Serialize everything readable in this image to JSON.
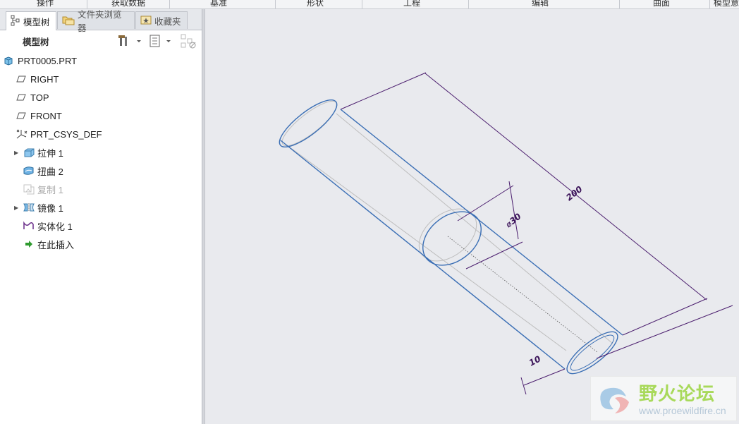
{
  "ribbon_groups": [
    "操作",
    "获取数据",
    "基准",
    "形状",
    "工程",
    "编辑",
    "曲面",
    "模型意"
  ],
  "panel_tabs": [
    {
      "label": "模型树",
      "icon": "model-tree-icon",
      "active": true
    },
    {
      "label": "文件夹浏览器",
      "icon": "folder-browser-icon",
      "active": false
    },
    {
      "label": "收藏夹",
      "icon": "favorites-icon",
      "active": false
    }
  ],
  "tree_header": {
    "title": "模型树"
  },
  "tree": {
    "root": {
      "label": "PRT0005.PRT",
      "icon": "part-icon"
    },
    "items": [
      {
        "label": "RIGHT",
        "icon": "datum-plane-icon",
        "expandable": false,
        "disabled": false
      },
      {
        "label": "TOP",
        "icon": "datum-plane-icon",
        "expandable": false,
        "disabled": false
      },
      {
        "label": "FRONT",
        "icon": "datum-plane-icon",
        "expandable": false,
        "disabled": false
      },
      {
        "label": "PRT_CSYS_DEF",
        "icon": "coordinate-system-icon",
        "expandable": false,
        "disabled": false
      },
      {
        "label": "拉伸 1",
        "icon": "extrude-icon",
        "expandable": true,
        "disabled": false
      },
      {
        "label": "扭曲 2",
        "icon": "warp-icon",
        "expandable": false,
        "disabled": false
      },
      {
        "label": "复制 1",
        "icon": "copy-icon",
        "expandable": false,
        "disabled": true
      },
      {
        "label": "镜像 1",
        "icon": "mirror-icon",
        "expandable": true,
        "disabled": false
      },
      {
        "label": "实体化 1",
        "icon": "solidify-icon",
        "expandable": false,
        "disabled": false
      },
      {
        "label": "在此插入",
        "icon": "insert-here-arrow-icon",
        "expandable": false,
        "disabled": false
      }
    ]
  },
  "dimensions": {
    "length": "200",
    "diameter": "⌀30",
    "offset": "10"
  },
  "watermark": {
    "text": "野火论坛",
    "url": "www.proewildfire.cn"
  },
  "colors": {
    "model_edge": "#3b6fb5",
    "dimension": "#4b1e6e",
    "hidden_edge": "#b8b8b8"
  }
}
